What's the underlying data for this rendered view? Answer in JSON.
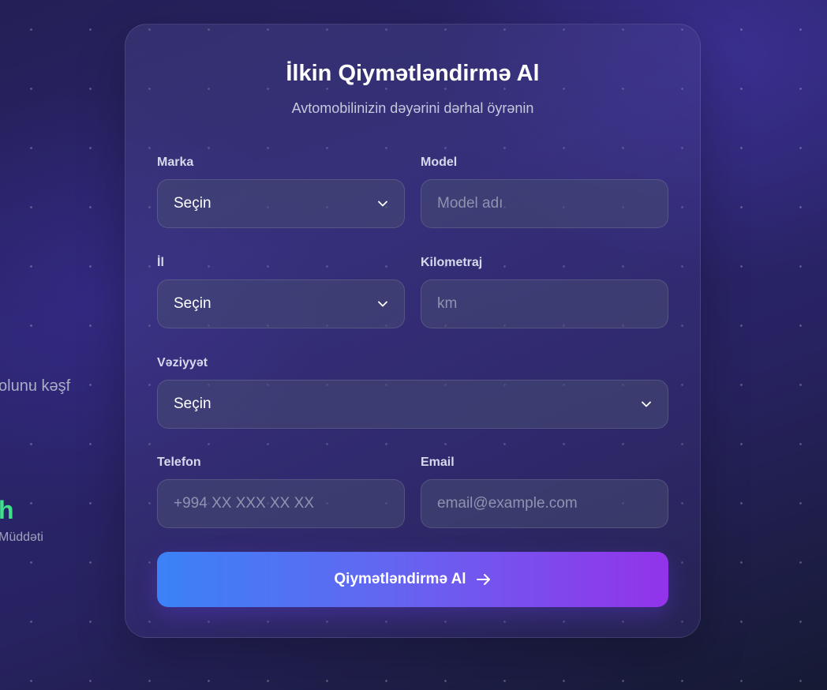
{
  "background_side": {
    "partial_text": "olunu kəşf",
    "stat_value": "h",
    "stat_label": "Müddəti"
  },
  "form": {
    "title": "İlkin Qiymətləndirmə Al",
    "subtitle": "Avtomobilinizin dəyərini dərhal öyrənin",
    "fields": {
      "brand": {
        "label": "Marka",
        "value": "Seçin",
        "icon": "chevron-down-icon"
      },
      "model": {
        "label": "Model",
        "placeholder": "Model adı"
      },
      "year": {
        "label": "İl",
        "value": "Seçin",
        "icon": "chevron-down-icon"
      },
      "mileage": {
        "label": "Kilometraj",
        "placeholder": "km"
      },
      "condition": {
        "label": "Vəziyyət",
        "value": "Seçin",
        "icon": "chevron-down-icon"
      },
      "phone": {
        "label": "Telefon",
        "placeholder": "+994 XX XXX XX XX"
      },
      "email": {
        "label": "Email",
        "placeholder": "email@example.com"
      }
    },
    "submit": {
      "label": "Qiymətləndirmə Al",
      "icon": "arrow-right-icon"
    }
  },
  "colors": {
    "accent_start": "#3b82f6",
    "accent_end": "#9333ea",
    "stat_green": "#3fe08a"
  }
}
